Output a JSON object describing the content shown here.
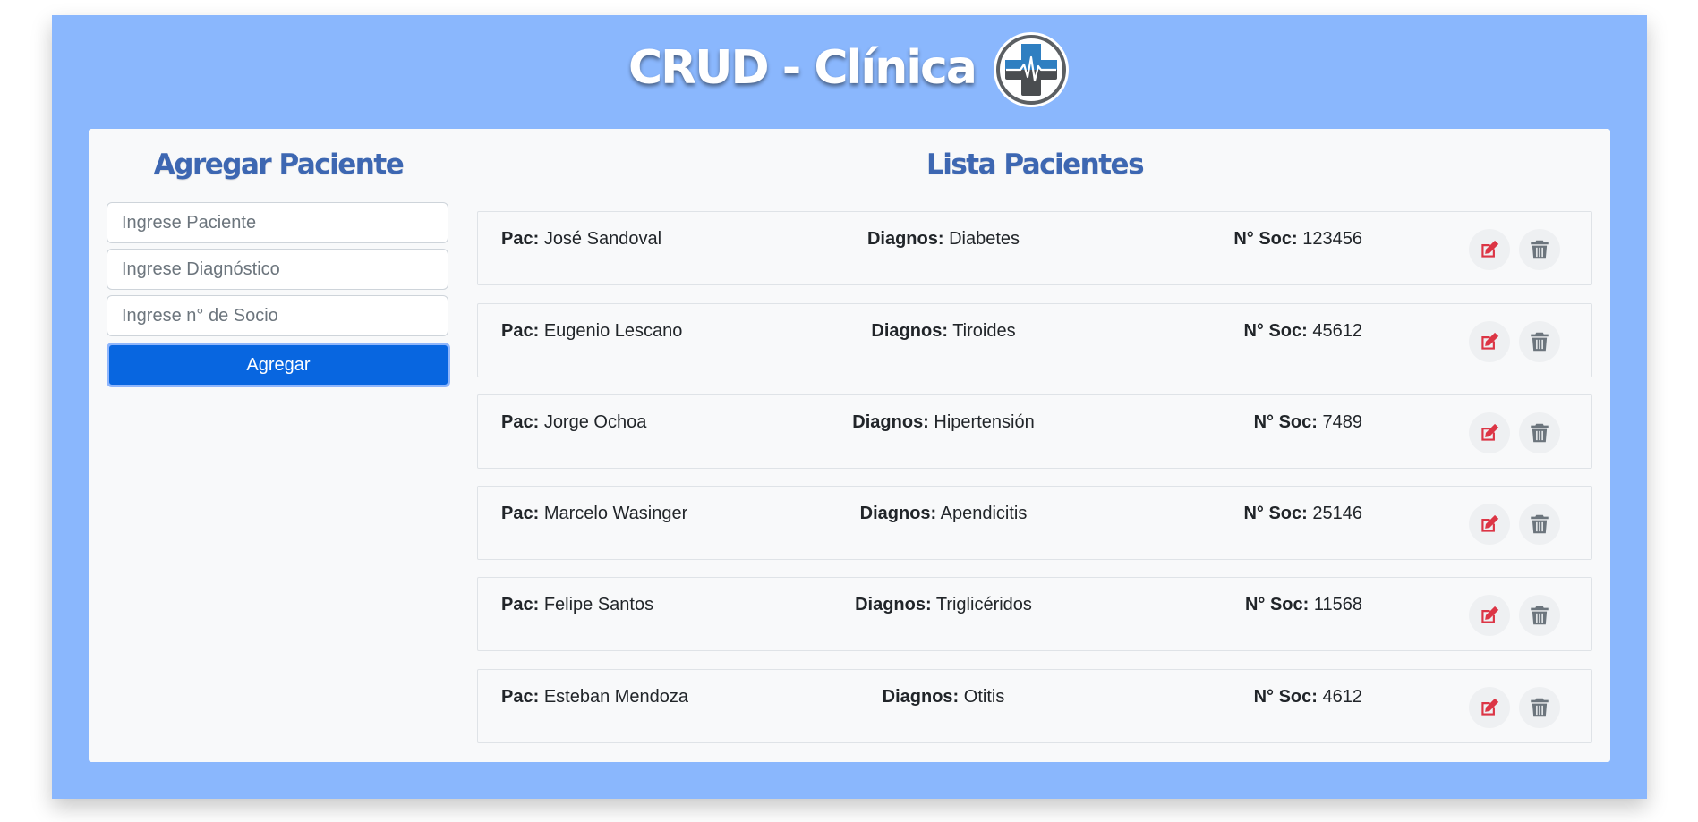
{
  "header": {
    "title": "CRUD - Clínica",
    "logo_icon": "medical-cross-heartbeat-icon"
  },
  "form": {
    "title": "Agregar Paciente",
    "patient_placeholder": "Ingrese Paciente",
    "diagnosis_placeholder": "Ingrese Diagnóstico",
    "member_placeholder": "Ingrese n° de Socio",
    "submit_label": "Agregar"
  },
  "list": {
    "title": "Lista Pacientes",
    "labels": {
      "patient": "Pac:",
      "diagnosis": "Diagnos:",
      "member": "N° Soc:"
    },
    "rows": [
      {
        "name": "José Sandoval",
        "diagnosis": "Diabetes",
        "member": "123456"
      },
      {
        "name": "Eugenio Lescano",
        "diagnosis": "Tiroides",
        "member": "45612"
      },
      {
        "name": "Jorge Ochoa",
        "diagnosis": "Hipertensión",
        "member": "7489"
      },
      {
        "name": "Marcelo Wasinger",
        "diagnosis": "Apendicitis",
        "member": "25146"
      },
      {
        "name": "Felipe Santos",
        "diagnosis": "Triglicéridos",
        "member": "11568"
      },
      {
        "name": "Esteban Mendoza",
        "diagnosis": "Otitis",
        "member": "4612"
      }
    ]
  },
  "colors": {
    "background": "#8ab7fd",
    "panel": "#f8f9fa",
    "title_blue": "#3d67b2",
    "button_blue": "#0866e0",
    "edit_red": "#dc3545",
    "delete_gray": "#6c757d"
  }
}
